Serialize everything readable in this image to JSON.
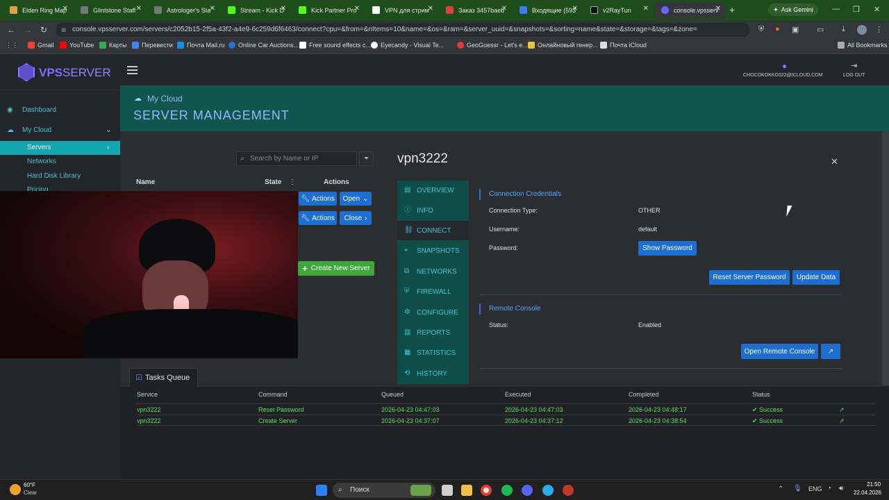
{
  "browser": {
    "tabs": [
      {
        "title": "Elden Ring Map",
        "color": "#e0a04a",
        "active": false
      },
      {
        "title": "Glintstone Staff",
        "color": "#888",
        "active": false
      },
      {
        "title": "Astrologer's Sta",
        "color": "#888",
        "active": false
      },
      {
        "title": "Stream - Kick D",
        "color": "#53fc18",
        "active": false
      },
      {
        "title": "Kick Partner Pro",
        "color": "#53fc18",
        "active": false
      },
      {
        "title": "VPN для стрим",
        "color": "#ffffff",
        "active": false
      },
      {
        "title": "Заказ 3457baeb",
        "color": "#e04040",
        "active": false
      },
      {
        "title": "Входящие (593",
        "color": "#3b7df0",
        "active": false
      },
      {
        "title": "v2RayTun",
        "color": "#222",
        "active": false
      },
      {
        "title": "console.vpsserv",
        "color": "#5b6cff",
        "active": true
      }
    ],
    "new_tab": "+",
    "ask_gemini": "Ask Gemini",
    "url": "console.vpsserver.com/servers/c2052b15-2f5a-43f2-a4e9-6c259d6f6463/connect?cpu=&from=&nItems=10&name=&os=&ram=&server_uuid=&snapshots=&sorting=name&state=&storage=&tags=&zone=",
    "bookmarks": [
      "Gmail",
      "YouTube",
      "Карты",
      "Перевести",
      "Почта Mail.ru",
      "Online Car Auctions...",
      "Free sound effects c...",
      "Eyecandy - Visual Te...",
      "GeoGuessr - Let's e...",
      "Онлайновый генер...",
      "Почта iCloud"
    ],
    "all_bookmarks": "All Bookmarks"
  },
  "app": {
    "logo_vps": "VPS",
    "logo_server": "SERVER",
    "user_email": "CHOCOKOKKO322@ICLOUD.COM",
    "logout": "LOG OUT",
    "breadcrumb": "My Cloud",
    "page_title": "SERVER MANAGEMENT",
    "sidebar": {
      "dashboard": "Dashboard",
      "my_cloud": "My Cloud",
      "servers": "Servers",
      "networks": "Networks",
      "hard_disk_library": "Hard Disk Library",
      "pricing": "Pricing"
    },
    "search_placeholder": "Search by Name or IP",
    "table_headers": {
      "name": "Name",
      "state": "State",
      "actions": "Actions"
    },
    "row_buttons": [
      {
        "actions": "Actions",
        "toggle": "Open"
      },
      {
        "actions": "Actions",
        "toggle": "Close"
      }
    ],
    "create_server": "Create New Server",
    "server_name": "vpn3222",
    "menu": [
      "OVERVIEW",
      "INFO",
      "CONNECT",
      "SNAPSHOTS",
      "NETWORKS",
      "FIREWALL",
      "CONFIGURE",
      "REPORTS",
      "STATISTICS",
      "HISTORY"
    ],
    "credentials": {
      "title": "Connection Credentials",
      "type_label": "Connection Type:",
      "type_value": "OTHER",
      "user_label": "Username:",
      "user_value": "default",
      "pass_label": "Password:",
      "show_password": "Show Password",
      "reset_password": "Reset Server Password",
      "update_data": "Update Data"
    },
    "remote_console": {
      "title": "Remote Console",
      "status_label": "Status:",
      "status_value": "Enabled",
      "open_button": "Open Remote Console"
    },
    "tasks": {
      "tab": "Tasks Queue",
      "headers": [
        "Service",
        "Command",
        "Queued",
        "Executed",
        "Completed",
        "Status"
      ],
      "rows": [
        {
          "service": "vpn3222",
          "command": "Reset Password",
          "queued": "2026-04-23 04:47:03",
          "executed": "2026-04-23 04:47:03",
          "completed": "2026-04-23 04:48:17",
          "status": "Success"
        },
        {
          "service": "vpn3222",
          "command": "Create Server",
          "queued": "2026-04-23 04:37:07",
          "executed": "2026-04-23 04:37:12",
          "completed": "2026-04-23 04:38:54",
          "status": "Success"
        }
      ]
    }
  },
  "taskbar": {
    "weather_temp": "60°F",
    "weather_desc": "Clear",
    "search": "Поиск",
    "lang": "ENG",
    "time": "21:50",
    "date": "22.04.2026"
  }
}
